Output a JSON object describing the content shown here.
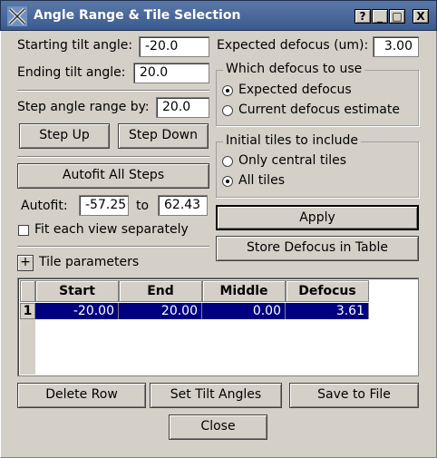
{
  "window": {
    "title": "Angle Range & Tile Selection",
    "controls": [
      "?",
      "_",
      "□",
      "X"
    ]
  },
  "tilt": {
    "starting_label": "Starting tilt angle:",
    "starting_value": "-20.0",
    "ending_label": "Ending tilt angle:",
    "ending_value": "20.0",
    "step_label": "Step angle range by:",
    "step_value": "20.0",
    "step_up": "Step Up",
    "step_down": "Step Down",
    "autofit_all": "Autofit All Steps",
    "autofit_label": "Autofit:",
    "autofit_from": "-57.25",
    "autofit_to_label": "to",
    "autofit_to": "62.43",
    "fit_each_label": "Fit each view separately",
    "fit_each_checked": false
  },
  "defocus": {
    "expected_label": "Expected defocus (um):",
    "expected_value": "3.00",
    "which_title": "Which defocus to use",
    "options": [
      {
        "label": "Expected defocus",
        "selected": true
      },
      {
        "label": "Current defocus estimate",
        "selected": false
      }
    ]
  },
  "tiles": {
    "title": "Initial tiles to include",
    "options": [
      {
        "label": "Only central tiles",
        "selected": false
      },
      {
        "label": "All tiles",
        "selected": true
      }
    ]
  },
  "actions": {
    "apply": "Apply",
    "store": "Store Defocus in Table"
  },
  "tile_params": {
    "toggle": "+",
    "label": "Tile parameters"
  },
  "table": {
    "columns": [
      "Start",
      "End",
      "Middle",
      "Defocus"
    ],
    "rows": [
      {
        "index": "1",
        "cells": [
          "-20.00",
          "20.00",
          "0.00",
          "3.61"
        ]
      }
    ]
  },
  "bottom": {
    "delete_row": "Delete Row",
    "set_tilt": "Set Tilt Angles",
    "save": "Save to File",
    "close": "Close"
  }
}
